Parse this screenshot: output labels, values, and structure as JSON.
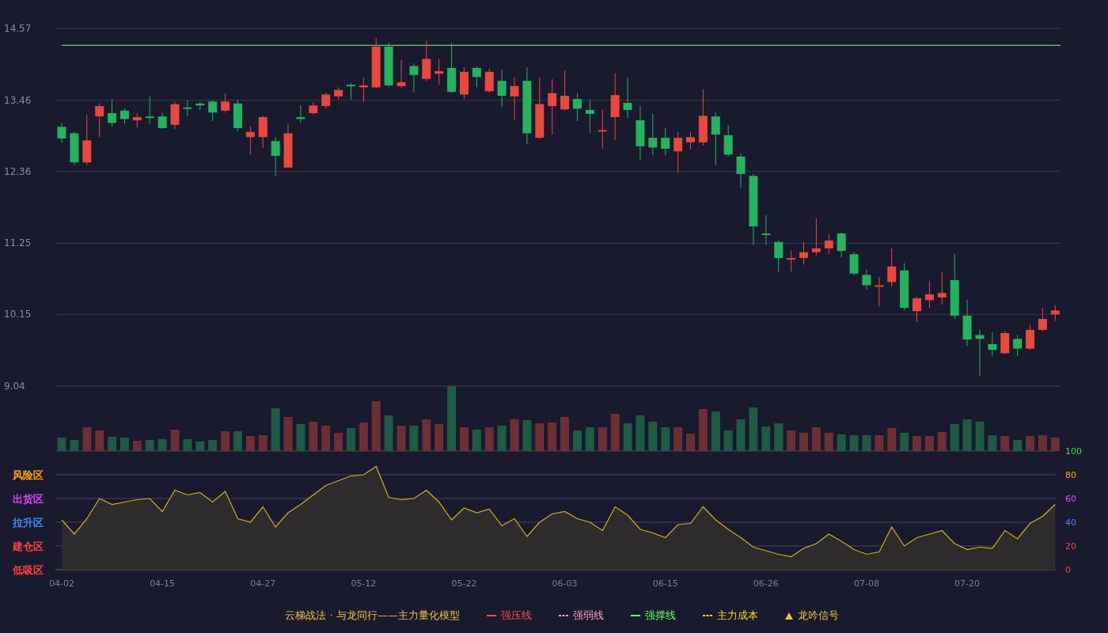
{
  "price_chart": {
    "chart_data": {
      "type": "candlestick",
      "grid": true,
      "ylim": [
        9.04,
        14.57
      ],
      "yticks": [
        14.57,
        13.46,
        12.36,
        11.25,
        10.15,
        9.04
      ],
      "ohlc": [
        [
          13.05,
          13.11,
          12.81,
          12.87
        ],
        [
          12.95,
          12.98,
          12.46,
          12.5
        ],
        [
          12.5,
          13.24,
          12.46,
          12.84
        ],
        [
          13.21,
          13.41,
          12.89,
          13.37
        ],
        [
          13.26,
          13.48,
          13.05,
          13.11
        ],
        [
          13.3,
          13.33,
          13.1,
          13.17
        ],
        [
          13.15,
          13.26,
          13.04,
          13.2
        ],
        [
          13.21,
          13.52,
          13.1,
          13.19
        ],
        [
          13.21,
          13.27,
          13.02,
          13.03
        ],
        [
          13.08,
          13.44,
          13.02,
          13.4
        ],
        [
          13.35,
          13.46,
          13.21,
          13.33
        ],
        [
          13.41,
          13.44,
          13.31,
          13.38
        ],
        [
          13.44,
          13.46,
          13.14,
          13.27
        ],
        [
          13.3,
          13.57,
          13.27,
          13.44
        ],
        [
          13.41,
          13.47,
          12.98,
          13.03
        ],
        [
          12.89,
          13.06,
          12.62,
          12.97
        ],
        [
          12.89,
          13.22,
          12.72,
          13.2
        ],
        [
          12.83,
          12.89,
          12.29,
          12.6
        ],
        [
          12.42,
          13.1,
          12.42,
          12.95
        ],
        [
          13.2,
          13.38,
          13.11,
          13.17
        ],
        [
          13.26,
          13.43,
          13.24,
          13.38
        ],
        [
          13.37,
          13.58,
          13.33,
          13.55
        ],
        [
          13.52,
          13.66,
          13.47,
          13.62
        ],
        [
          13.7,
          13.73,
          13.47,
          13.68
        ],
        [
          13.66,
          13.81,
          13.44,
          13.69
        ],
        [
          13.66,
          14.42,
          13.64,
          14.29
        ],
        [
          14.29,
          14.35,
          13.66,
          13.69
        ],
        [
          13.68,
          14.09,
          13.64,
          13.74
        ],
        [
          13.99,
          14.03,
          13.58,
          13.85
        ],
        [
          13.79,
          14.39,
          13.76,
          14.1
        ],
        [
          13.87,
          14.1,
          13.7,
          13.91
        ],
        [
          13.96,
          14.35,
          13.57,
          13.59
        ],
        [
          13.55,
          13.97,
          13.48,
          13.9
        ],
        [
          13.96,
          13.98,
          13.66,
          13.82
        ],
        [
          13.6,
          13.95,
          13.58,
          13.9
        ],
        [
          13.76,
          13.93,
          13.35,
          13.53
        ],
        [
          13.52,
          13.82,
          13.15,
          13.68
        ],
        [
          13.76,
          13.97,
          12.78,
          12.95
        ],
        [
          12.88,
          13.82,
          12.86,
          13.4
        ],
        [
          13.37,
          13.79,
          12.93,
          13.57
        ],
        [
          13.32,
          13.92,
          13.3,
          13.53
        ],
        [
          13.48,
          13.57,
          13.14,
          13.33
        ],
        [
          13.31,
          13.47,
          12.95,
          13.25
        ],
        [
          12.98,
          13.32,
          12.71,
          13.0
        ],
        [
          13.2,
          13.88,
          12.84,
          13.54
        ],
        [
          13.42,
          13.81,
          13.19,
          13.31
        ],
        [
          13.15,
          13.38,
          12.53,
          12.75
        ],
        [
          12.88,
          13.25,
          12.61,
          12.73
        ],
        [
          12.88,
          13.03,
          12.61,
          12.71
        ],
        [
          12.67,
          12.97,
          12.34,
          12.88
        ],
        [
          12.81,
          12.97,
          12.7,
          12.89
        ],
        [
          12.81,
          13.63,
          12.76,
          13.22
        ],
        [
          13.21,
          13.27,
          12.46,
          12.93
        ],
        [
          12.92,
          13.08,
          12.59,
          12.62
        ],
        [
          12.59,
          12.64,
          12.1,
          12.32
        ],
        [
          12.29,
          12.32,
          11.22,
          11.51
        ],
        [
          11.4,
          11.68,
          11.22,
          11.38
        ],
        [
          11.27,
          11.3,
          10.81,
          11.02
        ],
        [
          11.0,
          11.14,
          10.81,
          11.02
        ],
        [
          11.02,
          11.27,
          10.92,
          11.11
        ],
        [
          11.11,
          11.64,
          11.06,
          11.17
        ],
        [
          11.17,
          11.39,
          11.08,
          11.29
        ],
        [
          11.4,
          11.41,
          11.03,
          11.13
        ],
        [
          11.08,
          11.12,
          10.75,
          10.78
        ],
        [
          10.76,
          10.84,
          10.53,
          10.6
        ],
        [
          10.58,
          10.73,
          10.27,
          10.6
        ],
        [
          10.65,
          11.17,
          10.58,
          10.89
        ],
        [
          10.83,
          10.94,
          10.21,
          10.25
        ],
        [
          10.2,
          10.42,
          10.03,
          10.4
        ],
        [
          10.37,
          10.67,
          10.24,
          10.46
        ],
        [
          10.41,
          10.8,
          10.3,
          10.48
        ],
        [
          10.68,
          11.09,
          10.08,
          10.13
        ],
        [
          10.13,
          10.38,
          9.66,
          9.76
        ],
        [
          9.83,
          9.92,
          9.2,
          9.77
        ],
        [
          9.69,
          9.87,
          9.5,
          9.6
        ],
        [
          9.55,
          9.89,
          9.53,
          9.86
        ],
        [
          9.77,
          9.83,
          9.5,
          9.62
        ],
        [
          9.62,
          9.99,
          9.6,
          9.91
        ],
        [
          9.91,
          10.24,
          9.89,
          10.08
        ],
        [
          10.15,
          10.29,
          10.05,
          10.21
        ]
      ],
      "ref_lines": [
        {
          "axis": "y",
          "value": 14.31,
          "color": "#7cfc7c"
        }
      ]
    }
  },
  "indicator_chart": {
    "zones": [
      {
        "label": "风险区",
        "color": "#ffa500"
      },
      {
        "label": "出货区",
        "color": "#e040fb"
      },
      {
        "label": "拉升区",
        "color": "#3d8bff"
      },
      {
        "label": "建仓区",
        "color": "#ff4040"
      },
      {
        "label": "低吸区",
        "color": "#ff4040"
      }
    ],
    "chart_data": {
      "type": "area",
      "grid": true,
      "ylim": [
        0,
        100
      ],
      "yticks": [
        100,
        80,
        60,
        40,
        20,
        0
      ],
      "categories": [
        "04-02",
        null,
        null,
        null,
        null,
        null,
        null,
        null,
        "04-15",
        null,
        null,
        null,
        null,
        null,
        null,
        null,
        "04-27",
        null,
        null,
        null,
        null,
        null,
        null,
        null,
        "05-12",
        null,
        null,
        null,
        null,
        null,
        null,
        null,
        "05-22",
        null,
        null,
        null,
        null,
        null,
        null,
        null,
        "06-03",
        null,
        null,
        null,
        null,
        null,
        null,
        null,
        "06-15",
        null,
        null,
        null,
        null,
        null,
        null,
        null,
        "06-26",
        null,
        null,
        null,
        null,
        null,
        null,
        null,
        "07-08",
        null,
        null,
        null,
        null,
        null,
        null,
        null,
        "07-20",
        null,
        null,
        null,
        null,
        null,
        null,
        null
      ],
      "series": [
        {
          "color": "#d4b020",
          "values": [
            42,
            30,
            43,
            60,
            55,
            57,
            59,
            60,
            49,
            67,
            63,
            65,
            57,
            66,
            43,
            40,
            53,
            36,
            48,
            55,
            63,
            71,
            75,
            79,
            80,
            87,
            61,
            59,
            60,
            67,
            57,
            42,
            52,
            48,
            51,
            37,
            43,
            28,
            40,
            47,
            49,
            43,
            40,
            33,
            53,
            46,
            34,
            31,
            27,
            38,
            39,
            53,
            42,
            34,
            27,
            19,
            16,
            13,
            11,
            18,
            22,
            30,
            24,
            17,
            13,
            15,
            36,
            20,
            27,
            30,
            33,
            22,
            17,
            19,
            18,
            33,
            26,
            39,
            45,
            55
          ]
        }
      ]
    }
  },
  "legend": {
    "title": "云梯战法 · 与龙同行——主力量化模型",
    "items": [
      {
        "label": "强压线",
        "color": "#ff4d4d",
        "kind": "solid"
      },
      {
        "label": "强弱线",
        "color": "#ff9ec0",
        "kind": "dashed"
      },
      {
        "label": "强撑线",
        "color": "#66ff66",
        "kind": "solid"
      },
      {
        "label": "主力成本",
        "color": "#ffdd00",
        "kind": "dashed"
      },
      {
        "label": "龙吟信号",
        "color": "#f0c040",
        "kind": "triangle"
      }
    ]
  }
}
